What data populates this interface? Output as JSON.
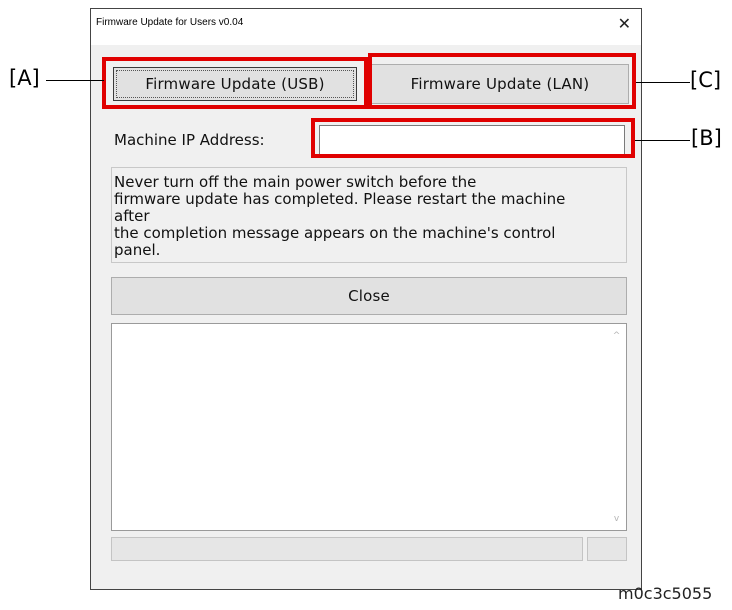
{
  "window": {
    "title": "Firmware Update for Users v0.04",
    "close_glyph": "✕"
  },
  "buttons": {
    "usb_label": "Firmware Update (USB)",
    "lan_label": "Firmware Update (LAN)",
    "close_label": "Close"
  },
  "ip": {
    "label": "Machine IP Address:",
    "value": ""
  },
  "message": {
    "lines": [
      "Never turn off the main power switch before the",
      "firmware update has completed. Please restart the machine",
      "after",
      "the completion message appears on the machine's control",
      "panel."
    ]
  },
  "log": {
    "scroll_up_glyph": "^",
    "scroll_down_glyph": "v"
  },
  "annotations": {
    "a": "[A]",
    "b": "[B]",
    "c": "[C]",
    "highlight_color": "#e00000"
  },
  "figure_code": "m0c3c5055"
}
